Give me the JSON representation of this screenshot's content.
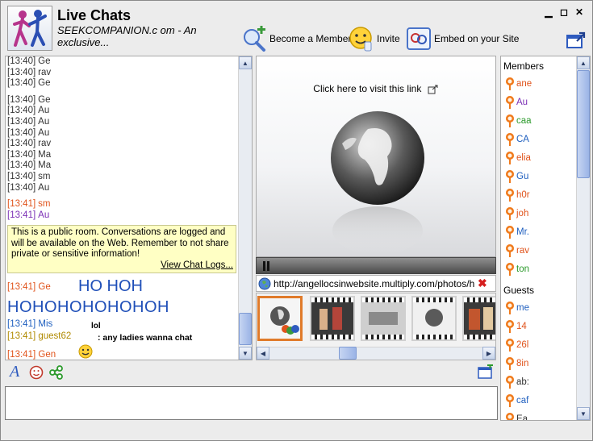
{
  "app": {
    "title": "Live Chats",
    "subtitle": "SEEKCOMPANION.c om - An exclusive..."
  },
  "window_controls": {
    "minimize": "▁",
    "maximize": "◻",
    "close": "✕"
  },
  "header_buttons": {
    "become_member": "Become a Member",
    "invite": "Invite",
    "embed": "Embed on your Site"
  },
  "chat": {
    "group1": [
      {
        "time": "[13:40]",
        "name": "Ge",
        "color": "#333333"
      },
      {
        "time": "[13:40]",
        "name": "rav",
        "color": "#333333"
      },
      {
        "time": "[13:40]",
        "name": "Ge",
        "color": "#333333"
      }
    ],
    "group2": [
      {
        "time": "[13:40]",
        "name": "Ge",
        "color": "#333333"
      },
      {
        "time": "[13:40]",
        "name": "Au",
        "color": "#333333"
      },
      {
        "time": "[13:40]",
        "name": "Au",
        "color": "#333333"
      },
      {
        "time": "[13:40]",
        "name": "Au",
        "color": "#333333"
      },
      {
        "time": "[13:40]",
        "name": "rav",
        "color": "#333333"
      },
      {
        "time": "[13:40]",
        "name": "Ma",
        "color": "#333333"
      },
      {
        "time": "[13:40]",
        "name": "Ma",
        "color": "#333333"
      },
      {
        "time": "[13:40]",
        "name": "sm",
        "color": "#333333"
      },
      {
        "time": "[13:40]",
        "name": "Au",
        "color": "#333333"
      }
    ],
    "group3": [
      {
        "time": "[13:41]",
        "name": "sm",
        "color": "#e0531b"
      },
      {
        "time": "[13:41]",
        "name": "Au",
        "color": "#7b2fb5"
      }
    ],
    "notice": "This is a public room. Conversations are logged and will be available on the Web. Remember to not share private or sensitive information!",
    "view_logs": "View Chat Logs...",
    "later": {
      "ge_time": "[13:41]",
      "ge_name": "Ge",
      "ge_text": "HO HOH",
      "hoho_text": "HOHOHOHOHOHOH",
      "mis_time": "[13:41]",
      "mis_name": "Mis",
      "mis_text": "lol",
      "guest_time": "[13:41]",
      "guest_name": "guest62",
      "guest_text": ": any ladies wanna chat",
      "gen_time": "[13:41]",
      "gen_name": "Gen"
    }
  },
  "media": {
    "link_text": "Click here to visit this link",
    "url": "http://angellocsinwebsite.multiply.com/photos/hi-r"
  },
  "members": {
    "members_label": "Members",
    "guests_label": "Guests",
    "members_list": [
      {
        "name": "ane",
        "color": "#e0531b"
      },
      {
        "name": "Au",
        "color": "#7b2fb5"
      },
      {
        "name": "caa",
        "color": "#2c9a2c"
      },
      {
        "name": "CA",
        "color": "#1f5fbf"
      },
      {
        "name": "elia",
        "color": "#e0531b"
      },
      {
        "name": "Gu",
        "color": "#1f5fbf"
      },
      {
        "name": "h0r",
        "color": "#e0531b"
      },
      {
        "name": "joh",
        "color": "#e0531b"
      },
      {
        "name": "Mr.",
        "color": "#1f5fbf"
      },
      {
        "name": "rav",
        "color": "#e0531b"
      },
      {
        "name": "ton",
        "color": "#2c9a2c"
      }
    ],
    "guests_list": [
      {
        "name": "me",
        "color": "#1f5fbf"
      },
      {
        "name": "14",
        "color": "#e0531b"
      },
      {
        "name": "26l",
        "color": "#e0531b"
      },
      {
        "name": "8in",
        "color": "#e0531b"
      },
      {
        "name": "ab:",
        "color": "#333333"
      },
      {
        "name": "caf",
        "color": "#1f5fbf"
      },
      {
        "name": "Ea",
        "color": "#333333"
      }
    ]
  }
}
